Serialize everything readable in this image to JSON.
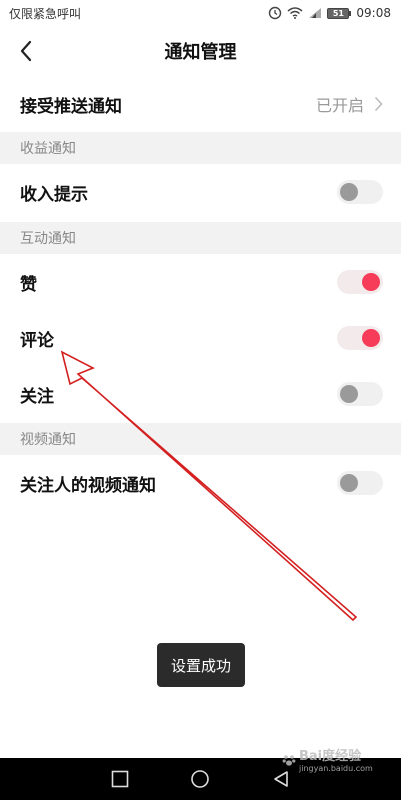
{
  "status": {
    "carrier": "仅限紧急呼叫",
    "battery": "51",
    "time": "09:08"
  },
  "header": {
    "title": "通知管理"
  },
  "push": {
    "label": "接受推送通知",
    "value": "已开启"
  },
  "sections": {
    "income": "收益通知",
    "interaction": "互动通知",
    "video": "视频通知"
  },
  "rows": {
    "income_tip": {
      "label": "收入提示",
      "on": false
    },
    "like": {
      "label": "赞",
      "on": true
    },
    "comment": {
      "label": "评论",
      "on": true
    },
    "follow": {
      "label": "关注",
      "on": false
    },
    "follow_video": {
      "label": "关注人的视频通知",
      "on": false
    }
  },
  "toast": {
    "text": "设置成功"
  },
  "colors": {
    "accent": "#f73c5a",
    "annotation_arrow": "#d42020"
  },
  "watermark": {
    "text": "Bai度经验",
    "sub": "jingyan.baidu.com"
  }
}
